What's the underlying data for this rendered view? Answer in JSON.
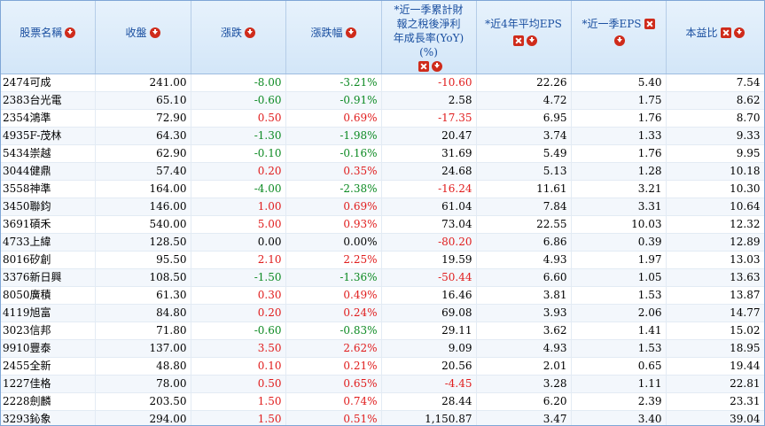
{
  "headers": {
    "name": "股票名稱",
    "close": "收盤",
    "change": "漲跌",
    "change_pct": "漲跌幅",
    "yoy_line1": "*近一季累計財",
    "yoy_line2": "報之稅後淨利",
    "yoy_line3": "年成長率(YoY)",
    "yoy_line4": "(%)",
    "eps4": "*近4年平均EPS",
    "eps_q": "*近一季EPS",
    "pe": "本益比"
  },
  "rows": [
    {
      "name": "2474可成",
      "close": "241.00",
      "change": "-8.00",
      "change_pct": "-3.21%",
      "yoy": "-10.60",
      "eps4": "22.26",
      "eps_q": "5.40",
      "pe": "7.54"
    },
    {
      "name": "2383台光電",
      "close": "65.10",
      "change": "-0.60",
      "change_pct": "-0.91%",
      "yoy": "2.58",
      "eps4": "4.72",
      "eps_q": "1.75",
      "pe": "8.62"
    },
    {
      "name": "2354鴻準",
      "close": "72.90",
      "change": "0.50",
      "change_pct": "0.69%",
      "yoy": "-17.35",
      "eps4": "6.95",
      "eps_q": "1.76",
      "pe": "8.70"
    },
    {
      "name": "4935F-茂林",
      "close": "64.30",
      "change": "-1.30",
      "change_pct": "-1.98%",
      "yoy": "20.47",
      "eps4": "3.74",
      "eps_q": "1.33",
      "pe": "9.33"
    },
    {
      "name": "5434崇越",
      "close": "62.90",
      "change": "-0.10",
      "change_pct": "-0.16%",
      "yoy": "31.69",
      "eps4": "5.49",
      "eps_q": "1.76",
      "pe": "9.95"
    },
    {
      "name": "3044健鼎",
      "close": "57.40",
      "change": "0.20",
      "change_pct": "0.35%",
      "yoy": "24.68",
      "eps4": "5.13",
      "eps_q": "1.28",
      "pe": "10.18"
    },
    {
      "name": "3558神準",
      "close": "164.00",
      "change": "-4.00",
      "change_pct": "-2.38%",
      "yoy": "-16.24",
      "eps4": "11.61",
      "eps_q": "3.21",
      "pe": "10.30"
    },
    {
      "name": "3450聯鈞",
      "close": "146.00",
      "change": "1.00",
      "change_pct": "0.69%",
      "yoy": "61.04",
      "eps4": "7.84",
      "eps_q": "3.31",
      "pe": "10.64"
    },
    {
      "name": "3691碩禾",
      "close": "540.00",
      "change": "5.00",
      "change_pct": "0.93%",
      "yoy": "73.04",
      "eps4": "22.55",
      "eps_q": "10.03",
      "pe": "12.32"
    },
    {
      "name": "4733上緯",
      "close": "128.50",
      "change": "0.00",
      "change_pct": "0.00%",
      "yoy": "-80.20",
      "eps4": "6.86",
      "eps_q": "0.39",
      "pe": "12.89"
    },
    {
      "name": "8016矽創",
      "close": "95.50",
      "change": "2.10",
      "change_pct": "2.25%",
      "yoy": "19.59",
      "eps4": "4.93",
      "eps_q": "1.97",
      "pe": "13.03"
    },
    {
      "name": "3376新日興",
      "close": "108.50",
      "change": "-1.50",
      "change_pct": "-1.36%",
      "yoy": "-50.44",
      "eps4": "6.60",
      "eps_q": "1.05",
      "pe": "13.63"
    },
    {
      "name": "8050廣積",
      "close": "61.30",
      "change": "0.30",
      "change_pct": "0.49%",
      "yoy": "16.46",
      "eps4": "3.81",
      "eps_q": "1.53",
      "pe": "13.87"
    },
    {
      "name": "4119旭富",
      "close": "84.80",
      "change": "0.20",
      "change_pct": "0.24%",
      "yoy": "69.08",
      "eps4": "3.93",
      "eps_q": "2.06",
      "pe": "14.77"
    },
    {
      "name": "3023信邦",
      "close": "71.80",
      "change": "-0.60",
      "change_pct": "-0.83%",
      "yoy": "29.11",
      "eps4": "3.62",
      "eps_q": "1.41",
      "pe": "15.02"
    },
    {
      "name": "9910豐泰",
      "close": "137.00",
      "change": "3.50",
      "change_pct": "2.62%",
      "yoy": "9.09",
      "eps4": "4.93",
      "eps_q": "1.53",
      "pe": "18.95"
    },
    {
      "name": "2455全新",
      "close": "48.80",
      "change": "0.10",
      "change_pct": "0.21%",
      "yoy": "20.56",
      "eps4": "2.01",
      "eps_q": "0.65",
      "pe": "19.44"
    },
    {
      "name": "1227佳格",
      "close": "78.00",
      "change": "0.50",
      "change_pct": "0.65%",
      "yoy": "-4.45",
      "eps4": "3.28",
      "eps_q": "1.11",
      "pe": "22.81"
    },
    {
      "name": "2228劍麟",
      "close": "203.50",
      "change": "1.50",
      "change_pct": "0.74%",
      "yoy": "28.44",
      "eps4": "6.20",
      "eps_q": "2.39",
      "pe": "23.31"
    },
    {
      "name": "3293鈊象",
      "close": "294.00",
      "change": "1.50",
      "change_pct": "0.51%",
      "yoy": "1,150.87",
      "eps4": "3.47",
      "eps_q": "3.40",
      "pe": "39.04"
    }
  ]
}
